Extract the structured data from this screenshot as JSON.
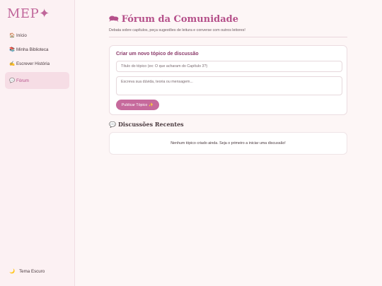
{
  "sidebar": {
    "logo": "MEP✦",
    "items": [
      {
        "icon": "🏠",
        "label": "Início"
      },
      {
        "icon": "📚",
        "label": "Minha Biblioteca"
      },
      {
        "icon": "✍️",
        "label": "Escrever História"
      },
      {
        "icon": "💬",
        "label": "Fórum"
      }
    ],
    "theme_toggle": {
      "icon": "🌙",
      "label": "Tema Escuro"
    }
  },
  "main": {
    "title_icon": "🗪",
    "title": "Fórum da Comunidade",
    "subtitle": "Debata sobre capítulos, peça sugestões de leitura e converse com outros leitores!",
    "new_topic": {
      "heading": "Criar um novo tópico de discussão",
      "title_placeholder": "Título do tópico (ex: O que acharam do Capítulo 3?)",
      "message_placeholder": "Escreva sua dúvida, teoria ou mensagem...",
      "publish_label": "Publicar Tópico",
      "publish_icon": "✨"
    },
    "recent": {
      "icon": "💬",
      "heading": "Discussões Recentes",
      "empty_message": "Nenhum tópico criado ainda. Seja o primeiro a iniciar uma discussão!"
    }
  },
  "colors": {
    "accent": "#b5508a",
    "button": "#c66a9c",
    "sidebar_bg": "#fcf1f3",
    "active_bg": "#f6dde5",
    "page_bg": "#fdf6f6"
  }
}
